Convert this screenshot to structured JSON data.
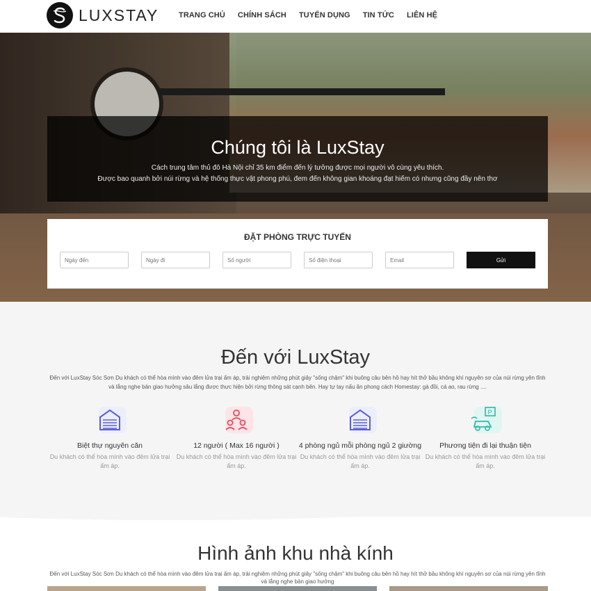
{
  "brand": {
    "name": "LUXSTAY"
  },
  "nav": {
    "items": [
      "TRANG CHỦ",
      "CHÍNH SÁCH",
      "TUYỂN DỤNG",
      "TIN TỨC",
      "LIÊN HỆ"
    ]
  },
  "hero": {
    "title": "Chúng tôi là LuxStay",
    "line1": "Cách trung tâm thủ đô Hà Nội chỉ 35 km điểm đến lý tưởng được mọi người vô cùng yêu thích.",
    "line2": "Được bao quanh bởi núi rừng và hệ thống thực vật phong phú, đem đến không gian khoáng đạt hiếm có nhưng cũng đầy nên thơ"
  },
  "booking": {
    "title": "ĐẶT PHÒNG TRỰC TUYẾN",
    "fields": [
      {
        "placeholder": "Ngày đến"
      },
      {
        "placeholder": "Ngày đi"
      },
      {
        "placeholder": "Số người"
      },
      {
        "placeholder": "Số điện thoại"
      },
      {
        "placeholder": "Email"
      }
    ],
    "submit_label": "Gửi"
  },
  "intro": {
    "title": "Đến với LuxStay",
    "desc": "Đến với LuxStay Sóc Sơn Du khách có thể hòa mình vào đêm lửa trại ấm áp, trải nghiệm những phút giây \"sống chậm\" khi buông câu bên hồ hay hít thở bầu không khí nguyên sơ của núi rừng yên tĩnh và lắng nghe bản giao hưởng sâu lắng được thực hiện bởi rừng thông sát cạnh bên. Hay tự tay nấu ăn phong cách Homestay: gà đồi, cá ao, rau rừng ...."
  },
  "features": [
    {
      "icon": "garage-icon",
      "title": "Biệt thự nguyên căn",
      "desc": "Du khách có thể hòa mình vào đêm lửa trại ấm áp."
    },
    {
      "icon": "people-icon",
      "title": "12 người ( Max 16 người )",
      "desc": "Du khách có thể hòa mình vào đêm lửa trại ấm áp."
    },
    {
      "icon": "garage-icon",
      "title": "4 phòng ngủ mỗi phòng ngủ 2 giường",
      "desc": "Du khách có thể hòa mình vào đêm lửa trại ấm áp."
    },
    {
      "icon": "parking-car-icon",
      "title": "Phương tiện đi lại thuận tiện",
      "desc": "Du khách có thể hòa mình vào đêm lửa trại ấm áp."
    }
  ],
  "gallery": {
    "title": "Hình ảnh khu nhà kính",
    "desc": "Đến với LuxStay Sóc Sơn Du khách có thể hòa mình vào đêm lửa trại ấm áp, trải nghiệm những phút giây \"sống chậm\" khi buông câu bên hồ hay hít thở bầu không khí nguyên sơ của núi rừng yên tĩnh và lắng nghe bản giao hưởng"
  },
  "colors": {
    "accent_purple": "#5a5fd6",
    "accent_red": "#e84a5f",
    "accent_teal": "#2fb8a6",
    "button_dark": "#111111"
  }
}
